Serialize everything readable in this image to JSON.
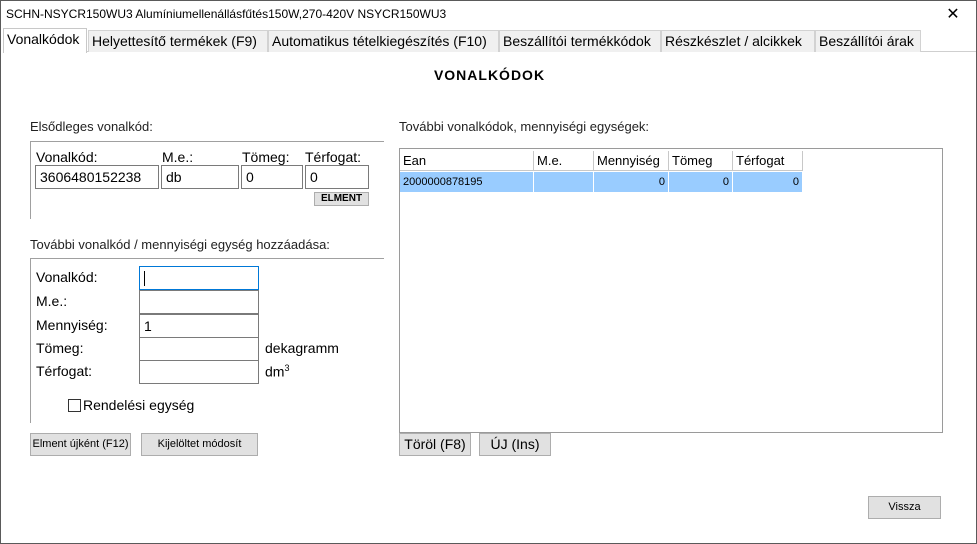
{
  "window": {
    "title": "SCHN-NSYCR150WU3    Alumíniumellenállásfűtés150W,270-420V NSYCR150WU3",
    "close_glyph": "✕"
  },
  "tabs": [
    {
      "label": "Vonalkódok",
      "active": true
    },
    {
      "label": "Helyettesítő termékek (F9)"
    },
    {
      "label": "Automatikus tételkiegészítés (F10)"
    },
    {
      "label": "Beszállítói termékkódok"
    },
    {
      "label": "Részkészlet / alcikkek"
    },
    {
      "label": "Beszállítói árak"
    }
  ],
  "heading": "VONALKÓDOK",
  "primary": {
    "group_label": "Elsődleges vonalkód:",
    "col_barcode": "Vonalkód:",
    "col_unit": "M.e.:",
    "col_weight": "Tömeg:",
    "col_volume": "Térfogat:",
    "barcode_value": "3606480152238",
    "unit_value": "db",
    "weight_value": "0",
    "volume_value": "0",
    "save_button": "ELMENT"
  },
  "add": {
    "group_label": "További vonalkód / mennyiségi egység hozzáadása:",
    "barcode_label": "Vonalkód:",
    "unit_label": "M.e.:",
    "quantity_label": "Mennyiség:",
    "weight_label": "Tömeg:",
    "volume_label": "Térfogat:",
    "barcode_value": "",
    "unit_value": "",
    "quantity_value": "1",
    "weight_value": "",
    "volume_value": "",
    "weight_unit": "dekagramm",
    "volume_unit": "dm",
    "volume_unit_sup": "3",
    "order_unit_label": "Rendelési egység",
    "order_unit_checked": false,
    "save_new_button": "Elment újként (F12)",
    "modify_selected_button": "Kijelöltet módosít"
  },
  "more": {
    "group_label": "További vonalkódok, mennyiségi egységek:",
    "columns": [
      "Ean",
      "M.e.",
      "Mennyiség",
      "Tömeg",
      "Térfogat"
    ],
    "rows": [
      {
        "ean": "2000000878195",
        "unit": "",
        "quantity": "0",
        "weight": "0",
        "volume": "0",
        "selected": true
      }
    ],
    "delete_button": "Töröl (F8)",
    "new_button": "ÚJ (Ins)"
  },
  "back_button": "Vissza",
  "colors": {
    "selection": "#99ccff",
    "focus_border": "#0078d7"
  }
}
